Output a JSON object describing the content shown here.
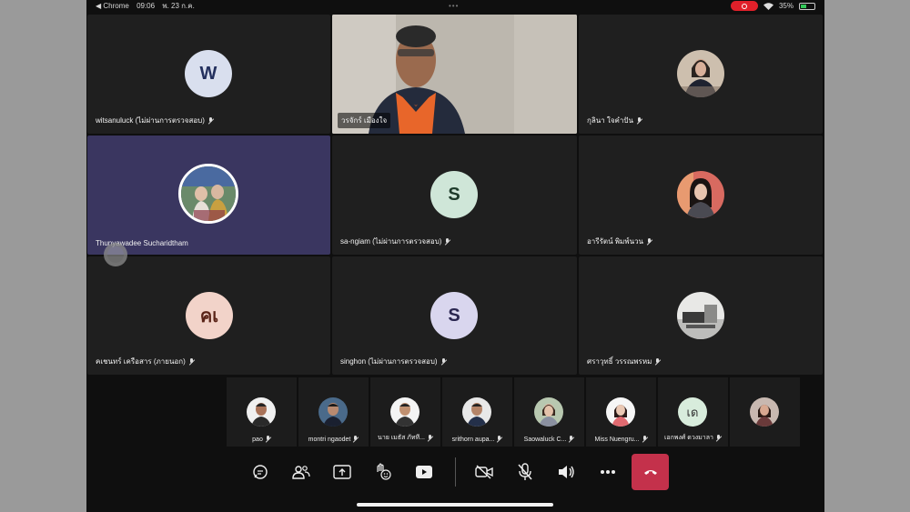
{
  "status_bar": {
    "app": "◀ Chrome",
    "time": "09:06",
    "date": "พ. 23 ก.ค.",
    "battery": "35%"
  },
  "tiles": [
    {
      "name": "witsanuluck (ไม่ผ่านการตรวจสอบ)",
      "initial": "W",
      "avatar_color": "#d9dfee"
    },
    {
      "name": "วรจักร์  เมืองใจ"
    },
    {
      "name": "กุลินา   ใจคำปัน"
    },
    {
      "name": "Thunyawadee Sucharidtham"
    },
    {
      "name": "sa-ngiam (ไม่ผ่านการตรวจสอบ)",
      "initial": "S",
      "avatar_color": "#cfe6d8"
    },
    {
      "name": "อารีรัตน์  พิมพ์นวน"
    },
    {
      "name": "คเชนทร์ เครือสาร (ภายนอก)",
      "initial": "คเ",
      "avatar_color": "#f2d3c9"
    },
    {
      "name": "singhon (ไม่ผ่านการตรวจสอบ)",
      "initial": "S",
      "avatar_color": "#d9d6ee"
    },
    {
      "name": "ศราวุทธิ์   วรรณพรหม"
    }
  ],
  "mini_tiles": [
    {
      "name": "pao"
    },
    {
      "name": "montri  ngaodet"
    },
    {
      "name": "นาย เมธัส  ภัทที..."
    },
    {
      "name": "srithorn aupa..."
    },
    {
      "name": "Saowaluck  C..."
    },
    {
      "name": "Miss Nuengru..."
    },
    {
      "name": "เอกพงศ์ ดวงมาลา",
      "initial": "เด"
    },
    {
      "name": ""
    }
  ],
  "icons": {
    "chat": "chat-icon",
    "people": "people-icon",
    "share": "share-screen-icon",
    "reactions": "raise-hand-icon",
    "apps": "video-app-icon",
    "camera": "camera-off-icon",
    "mic": "mic-off-icon",
    "speaker": "speaker-icon",
    "more": "more-icon",
    "hangup": "hang-up-icon"
  },
  "colors": {
    "hangup": "#c4314b",
    "highlight": "#3a3660",
    "recording": "#e0202a"
  }
}
